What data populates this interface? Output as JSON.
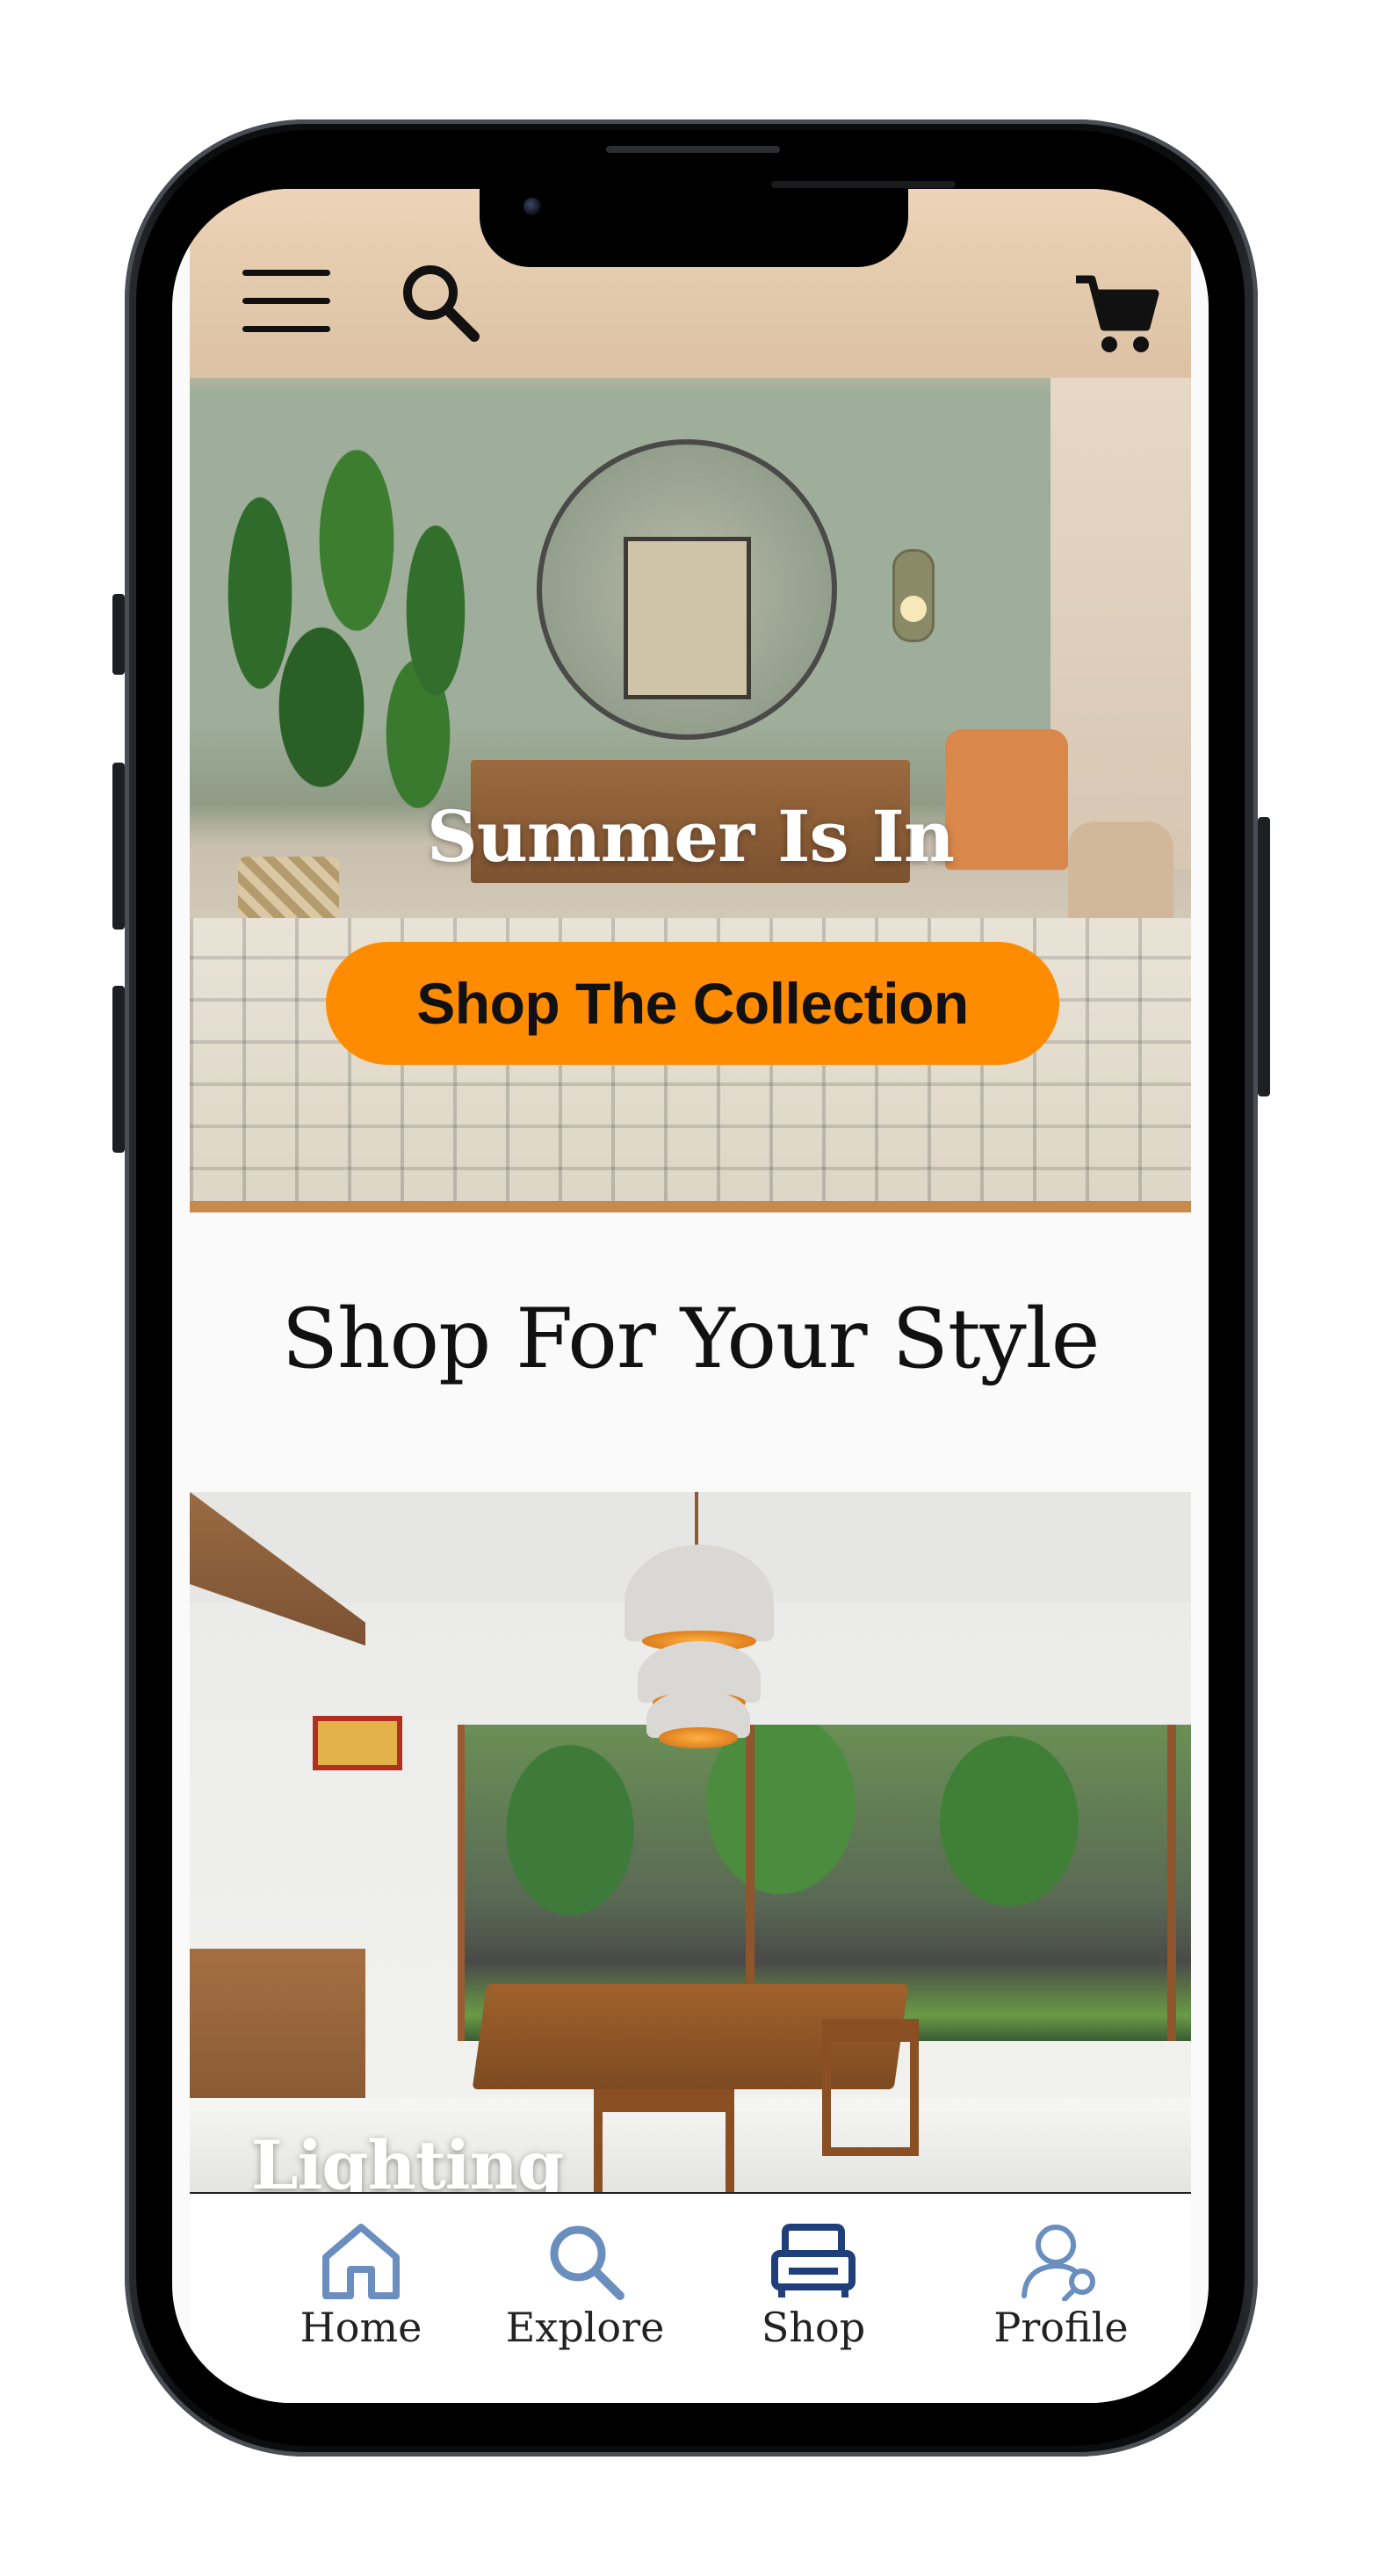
{
  "top_bar": {
    "menu_icon": "hamburger-menu-icon",
    "search_icon": "search-icon",
    "cart_icon": "shopping-cart-icon"
  },
  "hero": {
    "title": "Summer Is In",
    "cta_label": "Shop The Collection",
    "cta_color": "#ff8c00"
  },
  "section": {
    "title": "Shop For Your Style"
  },
  "categories": [
    {
      "label": "Lighting"
    }
  ],
  "tab_bar": {
    "tabs": [
      {
        "label": "Home",
        "icon": "home-icon",
        "color": "#6a8fbf"
      },
      {
        "label": "Explore",
        "icon": "search-icon",
        "color": "#6a8fbf"
      },
      {
        "label": "Shop",
        "icon": "sofa-icon",
        "color": "#1f3f7a",
        "active": true
      },
      {
        "label": "Profile",
        "icon": "profile-search-icon",
        "color": "#6a8fbf"
      }
    ]
  }
}
